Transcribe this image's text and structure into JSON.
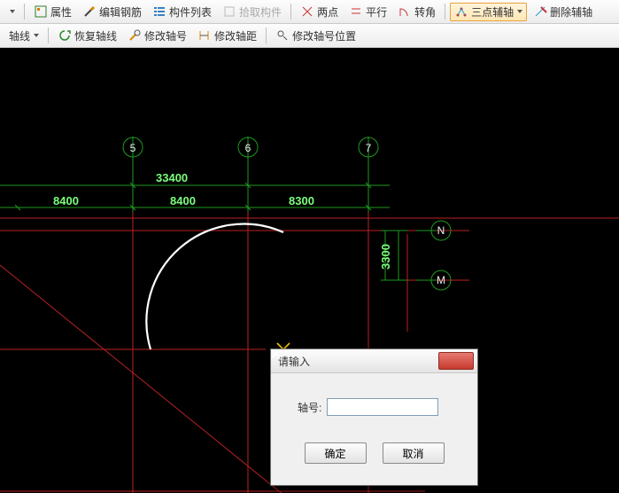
{
  "toolbar1": {
    "items": [
      {
        "name": "dropdown-small",
        "label": "",
        "icon": "drop",
        "interact": true
      },
      {
        "name": "sep"
      },
      {
        "name": "properties",
        "label": "属性",
        "icon": "props",
        "interact": true
      },
      {
        "name": "edit-rebar",
        "label": "编辑钢筋",
        "icon": "edit",
        "interact": true
      },
      {
        "name": "component-list",
        "label": "构件列表",
        "icon": "list",
        "interact": true
      },
      {
        "name": "pick-component",
        "label": "拾取构件",
        "icon": "pick",
        "interact": true,
        "disabled": true
      },
      {
        "name": "sep"
      },
      {
        "name": "two-points",
        "label": "两点",
        "icon": "two",
        "interact": true
      },
      {
        "name": "parallel",
        "label": "平行",
        "icon": "para",
        "interact": true
      },
      {
        "name": "turn-angle",
        "label": "转角",
        "icon": "turn",
        "interact": true
      },
      {
        "name": "three-point-aux",
        "label": "三点辅轴",
        "icon": "tpa",
        "interact": true,
        "active": true,
        "drop": true
      },
      {
        "name": "delete-aux",
        "label": "删除辅轴",
        "icon": "del",
        "interact": true
      }
    ]
  },
  "toolbar2": {
    "items": [
      {
        "name": "axis-line",
        "label": "轴线",
        "icon": "axisline",
        "interact": true,
        "drop": true
      },
      {
        "name": "sep"
      },
      {
        "name": "restore-axis",
        "label": "恢复轴线",
        "icon": "restore",
        "interact": true
      },
      {
        "name": "edit-axis-id",
        "label": "修改轴号",
        "icon": "editid",
        "interact": true
      },
      {
        "name": "edit-axis-dist",
        "label": "修改轴距",
        "icon": "editdist",
        "interact": true
      },
      {
        "name": "sep"
      },
      {
        "name": "edit-axis-id-pos",
        "label": "修改轴号位置",
        "icon": "editidpos",
        "interact": true
      }
    ]
  },
  "drawing": {
    "bubbles": {
      "a": "5",
      "b": "6",
      "c": "7",
      "n": "N",
      "m": "M"
    },
    "dims": {
      "total": "33400",
      "s1": "8400",
      "s2": "8400",
      "s3": "8300",
      "v1": "3300"
    }
  },
  "dialog": {
    "title": "请输入",
    "field_label": "轴号:",
    "value": "",
    "ok": "确定",
    "cancel": "取消"
  }
}
